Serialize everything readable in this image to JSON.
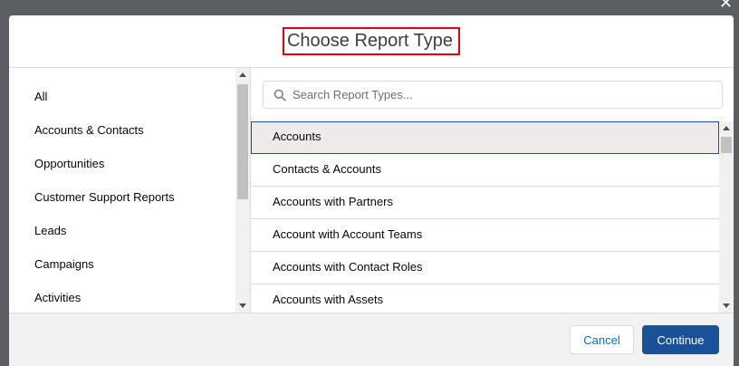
{
  "modal": {
    "title": "Choose Report Type",
    "close_glyph": "✕"
  },
  "categories": {
    "items": [
      {
        "label": "All"
      },
      {
        "label": "Accounts & Contacts"
      },
      {
        "label": "Opportunities"
      },
      {
        "label": "Customer Support Reports"
      },
      {
        "label": "Leads"
      },
      {
        "label": "Campaigns"
      },
      {
        "label": "Activities"
      }
    ]
  },
  "search": {
    "placeholder": "Search Report Types...",
    "value": "",
    "icon": "search-icon"
  },
  "report_types": {
    "selected_index": 0,
    "items": [
      {
        "label": "Accounts"
      },
      {
        "label": "Contacts & Accounts"
      },
      {
        "label": "Accounts with Partners"
      },
      {
        "label": "Account with Account Teams"
      },
      {
        "label": "Accounts with Contact Roles"
      },
      {
        "label": "Accounts with Assets"
      }
    ]
  },
  "footer": {
    "cancel_label": "Cancel",
    "continue_label": "Continue"
  },
  "colors": {
    "brand": "#1b5297",
    "link": "#0070d2",
    "title_highlight": "#e3000b",
    "selected_row_bg": "#ecebea"
  }
}
